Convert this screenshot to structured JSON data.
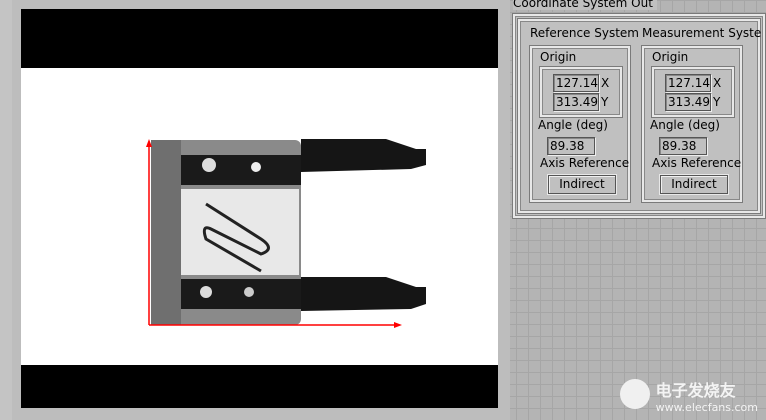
{
  "panel_title": "Coordinate System Out",
  "systems": [
    {
      "title": "Reference System",
      "origin_label": "Origin",
      "x": "127.14",
      "y": "313.49",
      "x_label": "X",
      "y_label": "Y",
      "angle_label": "Angle (deg)",
      "angle": "89.38",
      "axis_label": "Axis Reference",
      "axis": "Indirect"
    },
    {
      "title": "Measurement Syste",
      "origin_label": "Origin",
      "x": "127.14",
      "y": "313.49",
      "x_label": "X",
      "y_label": "Y",
      "angle_label": "Angle (deg)",
      "angle": "89.38",
      "axis_label": "Axis Reference",
      "axis": "Indirect"
    }
  ],
  "watermark": {
    "cn": "电子发烧友",
    "url": "www.elecfans.com"
  },
  "colors": {
    "axis": "#ff0000"
  }
}
